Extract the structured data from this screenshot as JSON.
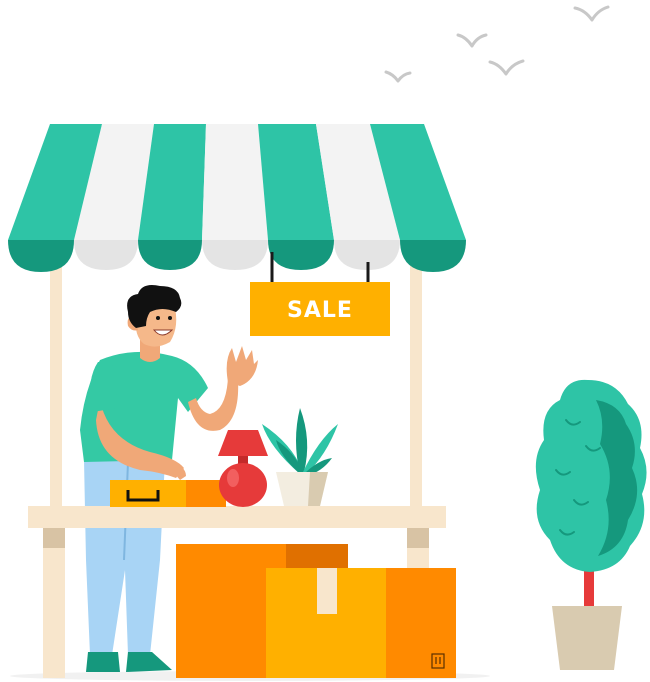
{
  "sign": {
    "label": "SALE"
  },
  "colors": {
    "awning_green": "#2ec4a6",
    "awning_green_dark": "#15987d",
    "awning_white": "#f3f3f3",
    "wood": "#f8e6cc",
    "wood_shadow": "#d8c3a4",
    "sign_yellow": "#ffb000",
    "box_orange": "#ff8a00",
    "box_yellow": "#ffb000",
    "shirt": "#34c9a4",
    "pants": "#a8d4f5",
    "lamp_red": "#e63a3a",
    "plant_green": "#2ec4a6",
    "pot": "#d9cbb0",
    "bird_gray": "#c8c8c8"
  },
  "icons": [
    "bird-icon",
    "fragile-label-icon",
    "suitcase-handle-icon"
  ]
}
